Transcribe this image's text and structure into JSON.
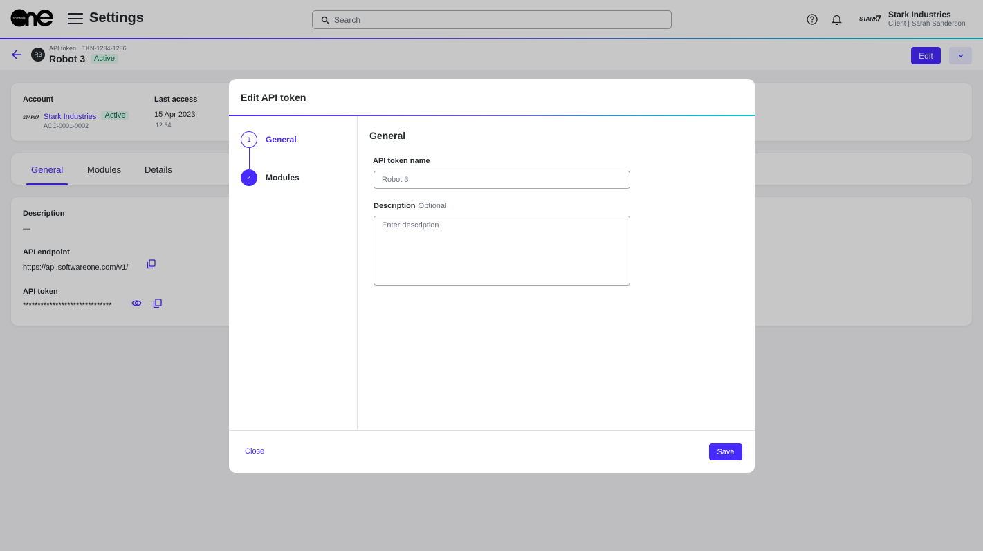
{
  "topbar": {
    "app_title": "Settings",
    "search_placeholder": "Search",
    "account_name": "Stark Industries",
    "account_sub": "Client | Sarah Sanderson"
  },
  "page_header": {
    "avatar_initials": "R3",
    "type_label": "API token",
    "token_id": "TKN-1234-1236",
    "name": "Robot 3",
    "status": "Active",
    "edit_label": "Edit"
  },
  "account_card": {
    "account_label": "Account",
    "account_name": "Stark Industries",
    "account_status": "Active",
    "account_id": "ACC-0001-0002",
    "last_access_label": "Last access",
    "last_access_date": "15 Apr 2023",
    "last_access_time": "12:34"
  },
  "tabs": [
    {
      "label": "General",
      "active": true
    },
    {
      "label": "Modules",
      "active": false
    },
    {
      "label": "Details",
      "active": false
    }
  ],
  "details_card": {
    "description_label": "Description",
    "description_value": "—",
    "endpoint_label": "API endpoint",
    "endpoint_value": "https://api.softwareone.com/v1/",
    "token_label": "API token",
    "token_value": "******************************"
  },
  "modal": {
    "title": "Edit API token",
    "steps": [
      {
        "number": "1",
        "label": "General",
        "state": "current"
      },
      {
        "number": "✓",
        "label": "Modules",
        "state": "completed"
      }
    ],
    "section_title": "General",
    "name_label": "API token name",
    "name_value": "Robot 3",
    "description_label": "Description",
    "description_optional": "Optional",
    "description_placeholder": "Enter description",
    "close_label": "Close",
    "save_label": "Save"
  },
  "colors": {
    "primary": "#472aff",
    "accent_teal": "#00c9cd",
    "success_bg": "#e6f9f1",
    "success_text": "#00784d"
  }
}
